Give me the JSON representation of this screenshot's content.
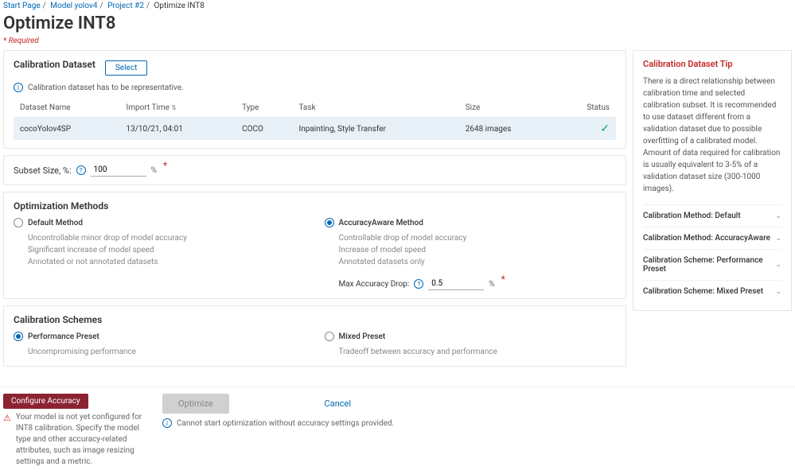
{
  "breadcrumb": [
    "Start Page",
    "Model yolov4",
    "Project #2",
    "Optimize INT8"
  ],
  "page_title": "Optimize INT8",
  "required_label": "* Required",
  "calib_dataset": {
    "title": "Calibration Dataset",
    "select_btn": "Select",
    "info": "Calibration dataset has to be representative.",
    "cols": [
      "Dataset Name",
      "Import Time",
      "Type",
      "Task",
      "Size",
      "Status"
    ],
    "row": {
      "name": "cocoYolov4SP",
      "time": "13/10/21, 04:01",
      "type": "COCO",
      "task": "Inpainting, Style Transfer",
      "size": "2648 images"
    }
  },
  "subset": {
    "label": "Subset Size, %:",
    "value": "100"
  },
  "methods": {
    "title": "Optimization Methods",
    "default": {
      "label": "Default Method",
      "desc": "Uncontrollable minor drop of model accuracy\nSignificant increase of model speed\nAnnotated or not annotated datasets"
    },
    "aa": {
      "label": "AccuracyAware Method",
      "desc": "Controllable drop of model accuracy\nIncrease of model speed\nAnnotated datasets only"
    },
    "maxacc": {
      "label": "Max Accuracy Drop:",
      "value": "0.5"
    }
  },
  "schemes": {
    "title": "Calibration Schemes",
    "perf": {
      "label": "Performance Preset",
      "desc": "Uncompromising performance"
    },
    "mixed": {
      "label": "Mixed Preset",
      "desc": "Tradeoff between accuracy and performance"
    }
  },
  "tip": {
    "title": "Calibration Dataset Tip",
    "body": "There is a direct relationship between calibration time and selected calibration subset. It is recommended to use dataset different from a validation dataset due to possible overfitting of a calibrated model. Amount of data required for calibration is usually equivalent to 3-5% of a validation dataset size (300-1000 images).",
    "acc": [
      "Calibration Method: Default",
      "Calibration Method: AccuracyAware",
      "Calibration Scheme: Performance Preset",
      "Calibration Scheme: Mixed Preset"
    ]
  },
  "footer": {
    "configure": "Configure Accuracy",
    "warning": "Your model is not yet configured for INT8 calibration. Specify the model type and other accuracy-related attributes, such as image resizing settings and a metric.",
    "optimize": "Optimize",
    "cancel": "Cancel",
    "error": "Cannot start optimization without accuracy settings provided."
  }
}
